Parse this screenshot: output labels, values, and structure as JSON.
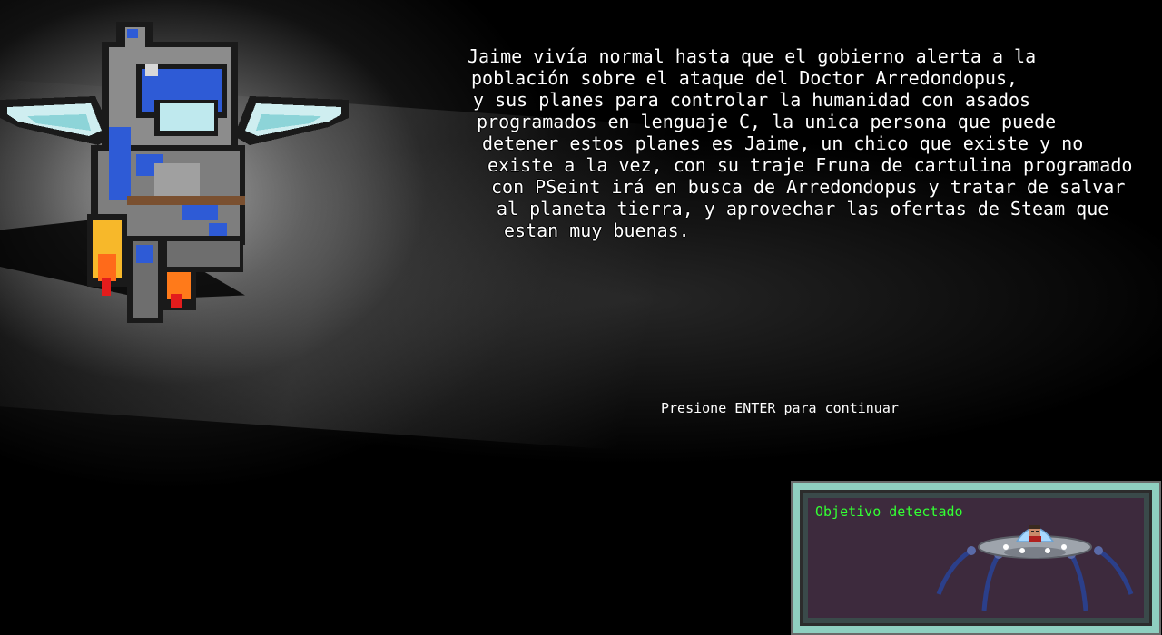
{
  "story": {
    "lines": [
      "Jaime vivía normal hasta que el gobierno alerta a la",
      "población sobre el ataque del Doctor Arredondopus,",
      "y sus planes para controlar la humanidad con asados",
      "programados en lenguaje C, la unica persona que puede",
      "detener estos planes es Jaime, un chico que existe y no",
      "existe a la vez, con su traje Fruna de cartulina programado",
      "con PSeint irá en busca de Arredondopus y tratar de salvar",
      "al planeta tierra, y aprovechar las ofertas de Steam que",
      "estan muy buenas."
    ]
  },
  "prompt": "Presione ENTER para continuar",
  "target_panel": {
    "title": "Objetivo detectado",
    "title_color": "#33ff33",
    "icon": "ufo-spider-icon"
  },
  "hero": {
    "icon": "armored-knight-jetpack-icon"
  },
  "colors": {
    "background": "#000000",
    "text": "#ffffff",
    "panel_frame": "#8fcfc0",
    "panel_screen": "#3d2a3d"
  }
}
